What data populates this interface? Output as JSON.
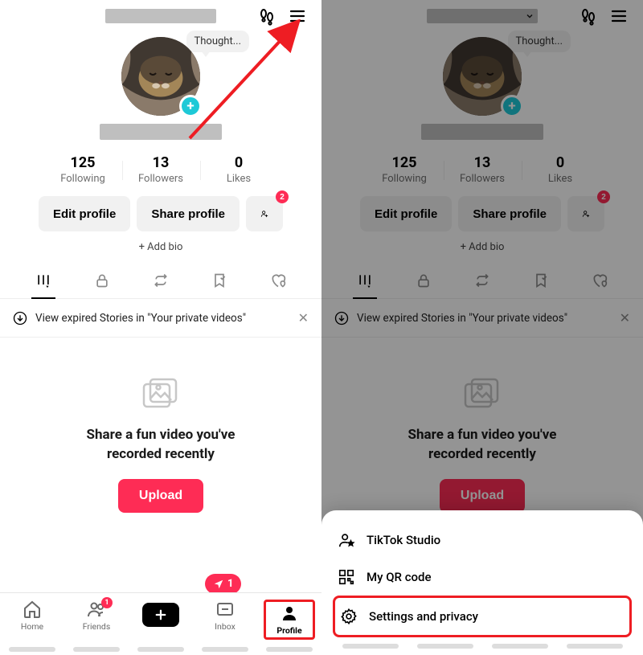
{
  "thought_label": "Thought...",
  "stats": {
    "following": {
      "n": "125",
      "l": "Following"
    },
    "followers": {
      "n": "13",
      "l": "Followers"
    },
    "likes": {
      "n": "0",
      "l": "Likes"
    }
  },
  "buttons": {
    "edit": "Edit profile",
    "share": "Share profile",
    "addfriend_badge": "2"
  },
  "add_bio": "+ Add bio",
  "banner_text": "View expired Stories in \"Your private videos\"",
  "empty_text": "Share a fun video you've\nrecorded recently",
  "upload_label": "Upload",
  "nav": {
    "home": "Home",
    "friends": "Friends",
    "friends_badge": "1",
    "inbox": "Inbox",
    "profile": "Profile",
    "inbox_pop": "1"
  },
  "sheet": {
    "studio": "TikTok Studio",
    "qr": "My QR code",
    "settings": "Settings and privacy"
  }
}
